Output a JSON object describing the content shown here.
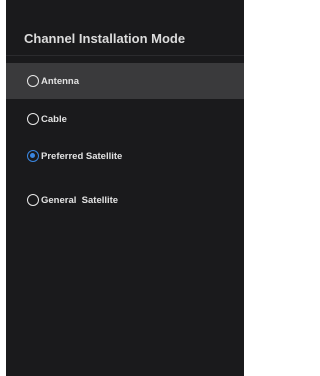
{
  "dialog": {
    "title": "Channel Installation Mode"
  },
  "options": [
    {
      "label": "Antenna",
      "selected": false,
      "focused": true
    },
    {
      "label": "Cable",
      "selected": false,
      "focused": false
    },
    {
      "label": "Preferred Satellite",
      "selected": true,
      "focused": false
    },
    {
      "label": "General  Satellite",
      "selected": false,
      "focused": false
    }
  ],
  "colors": {
    "panel_background": "#1a1a1c",
    "focus_highlight": "#3a3a3c",
    "selected_accent": "#3a86e0",
    "text": "#e2e2e2"
  }
}
